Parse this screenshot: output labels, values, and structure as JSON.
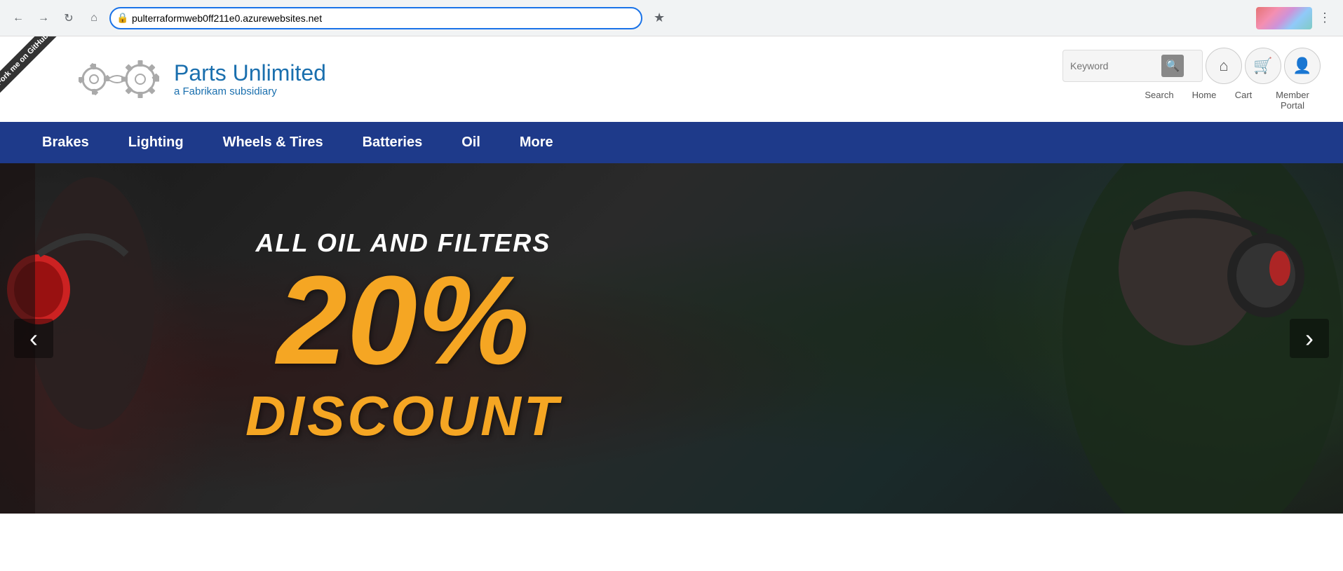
{
  "browser": {
    "url": "pulterraformweb0ff211e0.azurewebsites.net",
    "back_disabled": false,
    "forward_disabled": false
  },
  "site": {
    "fork_ribbon": "Fork me on GitHub",
    "logo": {
      "title": "Parts Unlimited",
      "subtitle": "a Fabrikam subsidiary"
    },
    "header": {
      "search_placeholder": "Keyword",
      "search_label": "Search",
      "home_label": "Home",
      "cart_label": "Cart",
      "member_portal_label": "Member Portal"
    },
    "nav": {
      "items": [
        {
          "label": "Brakes"
        },
        {
          "label": "Lighting"
        },
        {
          "label": "Wheels & Tires"
        },
        {
          "label": "Batteries"
        },
        {
          "label": "Oil"
        },
        {
          "label": "More"
        }
      ]
    },
    "hero": {
      "subtitle": "ALL OIL AND FILTERS",
      "percent": "20%",
      "discount": "DISCOUNT"
    }
  }
}
